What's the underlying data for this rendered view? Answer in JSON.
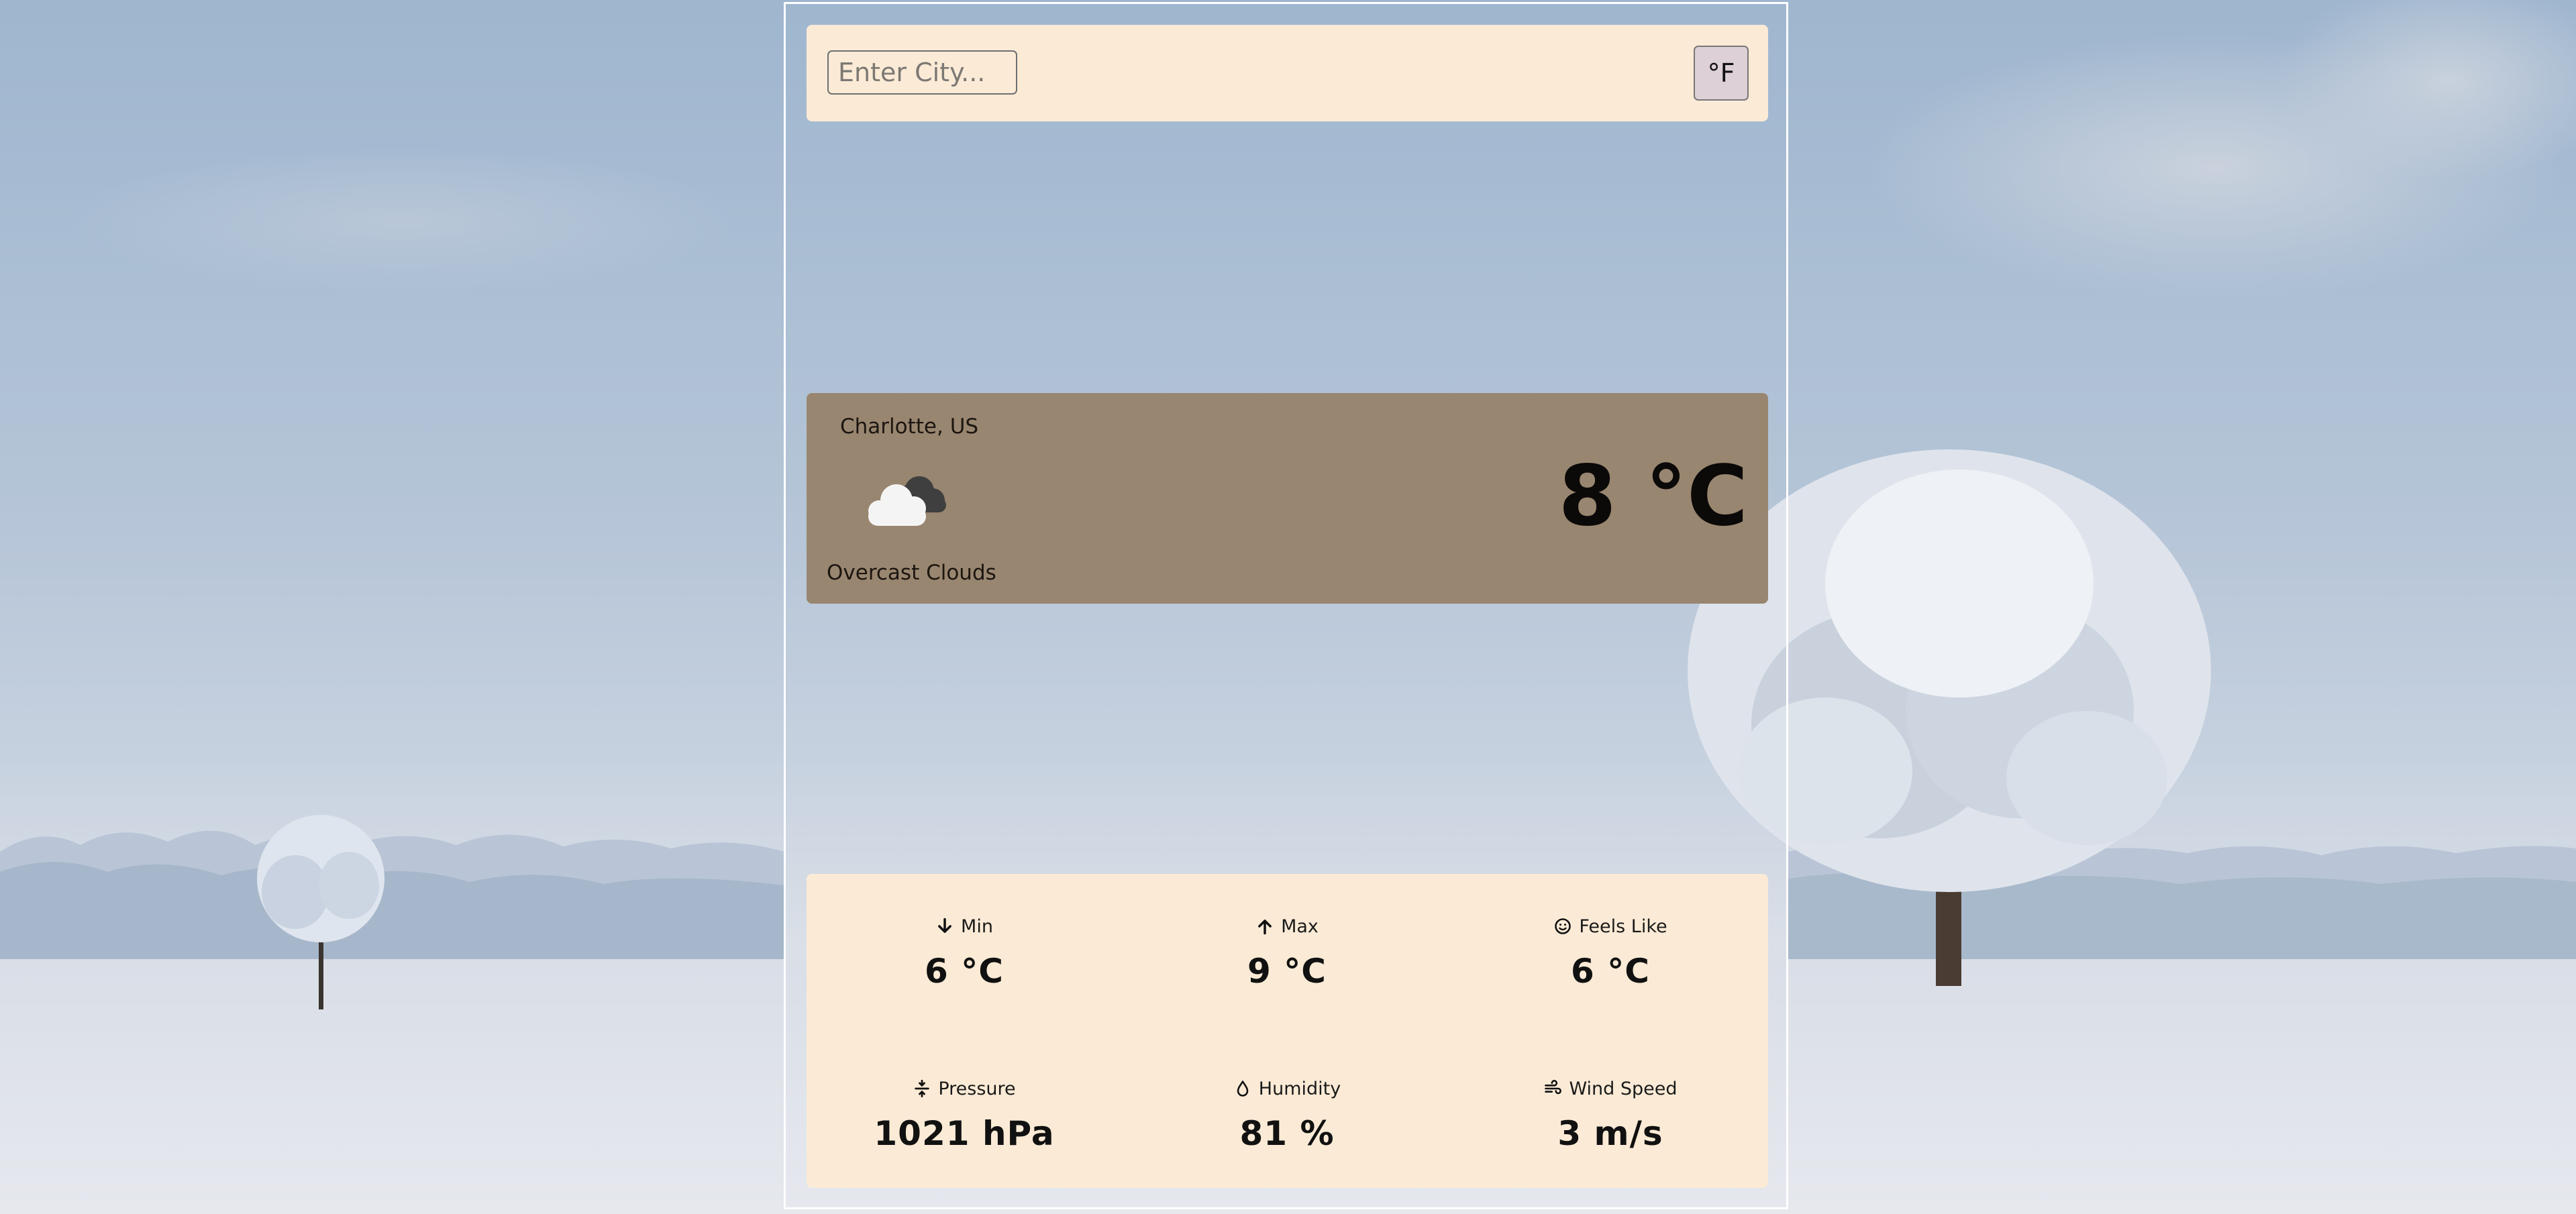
{
  "search": {
    "placeholder": "Enter City...",
    "unit_toggle_label": "°F"
  },
  "current": {
    "location": "Charlotte, US",
    "icon": "overcast-clouds-icon",
    "description": "Overcast Clouds",
    "temperature": "8 °C"
  },
  "details": {
    "min": {
      "label": "Min",
      "value": "6 °C",
      "icon": "arrow-down-icon"
    },
    "max": {
      "label": "Max",
      "value": "9 °C",
      "icon": "arrow-up-icon"
    },
    "feels_like": {
      "label": "Feels Like",
      "value": "6 °C",
      "icon": "smiley-icon"
    },
    "pressure": {
      "label": "Pressure",
      "value": "1021 hPa",
      "icon": "pressure-icon"
    },
    "humidity": {
      "label": "Humidity",
      "value": "81 %",
      "icon": "droplet-icon"
    },
    "wind_speed": {
      "label": "Wind Speed",
      "value": "3 m/s",
      "icon": "wind-icon"
    }
  },
  "colors": {
    "panel_cream": "#fbebd6",
    "current_card": "#998670",
    "toggle_bg": "#ddd0d7",
    "frame_border": "#ffffff"
  }
}
